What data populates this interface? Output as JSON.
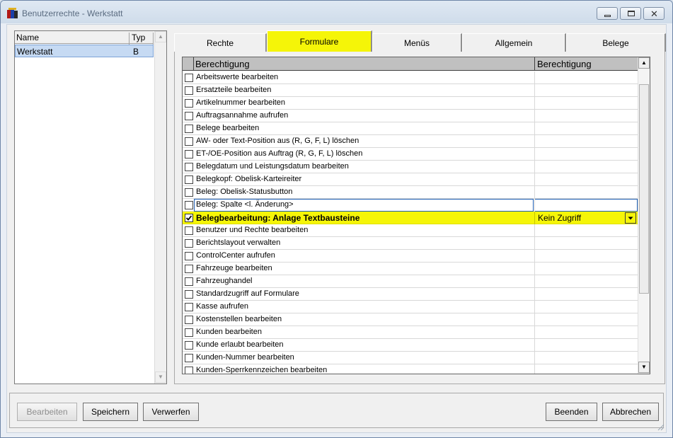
{
  "window": {
    "title": "Benutzerrechte - Werkstatt"
  },
  "userlist": {
    "columns": [
      "Name",
      "Typ"
    ],
    "rows": [
      {
        "name": "Werkstatt",
        "typ": "B"
      }
    ]
  },
  "tabs": [
    {
      "label": "Rechte",
      "active": false
    },
    {
      "label": "Formulare",
      "active": true
    },
    {
      "label": "Menüs",
      "active": false
    },
    {
      "label": "Allgemein",
      "active": false
    },
    {
      "label": "Belege",
      "active": false
    }
  ],
  "grid": {
    "columns": [
      "Berechtigung",
      "Berechtigung"
    ],
    "rows": [
      {
        "label": "Arbeitswerte bearbeiten",
        "checked": false,
        "value": ""
      },
      {
        "label": "Ersatzteile bearbeiten",
        "checked": false,
        "value": ""
      },
      {
        "label": "Artikelnummer bearbeiten",
        "checked": false,
        "value": ""
      },
      {
        "label": "Auftragsannahme aufrufen",
        "checked": false,
        "value": ""
      },
      {
        "label": "Belege bearbeiten",
        "checked": false,
        "value": ""
      },
      {
        "label": "AW- oder Text-Position aus (R, G, F, L) löschen",
        "checked": false,
        "value": ""
      },
      {
        "label": "ET-/OE-Position aus Auftrag (R, G, F, L) löschen",
        "checked": false,
        "value": ""
      },
      {
        "label": "Belegdatum und Leistungsdatum bearbeiten",
        "checked": false,
        "value": ""
      },
      {
        "label": "Belegkopf: Obelisk-Karteireiter",
        "checked": false,
        "value": ""
      },
      {
        "label": "Beleg: Obelisk-Statusbutton",
        "checked": false,
        "value": ""
      },
      {
        "label": "Beleg: Spalte <l. Änderung>",
        "checked": false,
        "value": "",
        "focus": true
      },
      {
        "label": "Belegbearbeitung: Anlage Textbausteine",
        "checked": true,
        "value": "Kein Zugriff",
        "selected": true
      },
      {
        "label": "Benutzer und Rechte bearbeiten",
        "checked": false,
        "value": ""
      },
      {
        "label": "Berichtslayout verwalten",
        "checked": false,
        "value": ""
      },
      {
        "label": "ControlCenter aufrufen",
        "checked": false,
        "value": ""
      },
      {
        "label": "Fahrzeuge bearbeiten",
        "checked": false,
        "value": ""
      },
      {
        "label": "Fahrzeughandel",
        "checked": false,
        "value": ""
      },
      {
        "label": "Standardzugriff auf Formulare",
        "checked": false,
        "value": ""
      },
      {
        "label": "Kasse aufrufen",
        "checked": false,
        "value": ""
      },
      {
        "label": "Kostenstellen bearbeiten",
        "checked": false,
        "value": ""
      },
      {
        "label": "Kunden bearbeiten",
        "checked": false,
        "value": ""
      },
      {
        "label": "Kunde erlaubt bearbeiten",
        "checked": false,
        "value": ""
      },
      {
        "label": "Kunden-Nummer bearbeiten",
        "checked": false,
        "value": ""
      },
      {
        "label": "Kunden-Sperrkennzeichen bearbeiten",
        "checked": false,
        "value": ""
      }
    ]
  },
  "buttons": {
    "bearbeiten": "Bearbeiten",
    "speichern": "Speichern",
    "verwerfen": "Verwerfen",
    "beenden": "Beenden",
    "abbrechen": "Abbrechen"
  },
  "colors": {
    "highlight": "#f5f508",
    "selection": "#c6daf3"
  }
}
